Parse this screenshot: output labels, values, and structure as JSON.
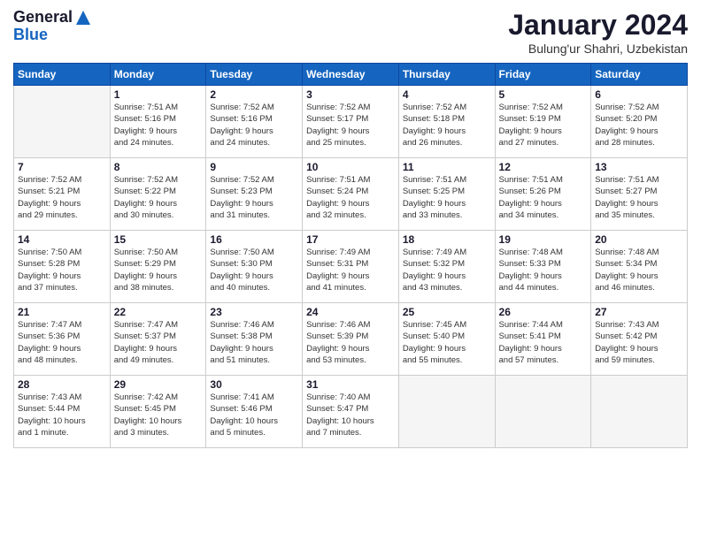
{
  "header": {
    "logo_line1": "General",
    "logo_line2": "Blue",
    "month_title": "January 2024",
    "location": "Bulung'ur Shahri, Uzbekistan"
  },
  "weekdays": [
    "Sunday",
    "Monday",
    "Tuesday",
    "Wednesday",
    "Thursday",
    "Friday",
    "Saturday"
  ],
  "weeks": [
    [
      {
        "day": "",
        "info": ""
      },
      {
        "day": "1",
        "info": "Sunrise: 7:51 AM\nSunset: 5:16 PM\nDaylight: 9 hours\nand 24 minutes."
      },
      {
        "day": "2",
        "info": "Sunrise: 7:52 AM\nSunset: 5:16 PM\nDaylight: 9 hours\nand 24 minutes."
      },
      {
        "day": "3",
        "info": "Sunrise: 7:52 AM\nSunset: 5:17 PM\nDaylight: 9 hours\nand 25 minutes."
      },
      {
        "day": "4",
        "info": "Sunrise: 7:52 AM\nSunset: 5:18 PM\nDaylight: 9 hours\nand 26 minutes."
      },
      {
        "day": "5",
        "info": "Sunrise: 7:52 AM\nSunset: 5:19 PM\nDaylight: 9 hours\nand 27 minutes."
      },
      {
        "day": "6",
        "info": "Sunrise: 7:52 AM\nSunset: 5:20 PM\nDaylight: 9 hours\nand 28 minutes."
      }
    ],
    [
      {
        "day": "7",
        "info": "Sunrise: 7:52 AM\nSunset: 5:21 PM\nDaylight: 9 hours\nand 29 minutes."
      },
      {
        "day": "8",
        "info": "Sunrise: 7:52 AM\nSunset: 5:22 PM\nDaylight: 9 hours\nand 30 minutes."
      },
      {
        "day": "9",
        "info": "Sunrise: 7:52 AM\nSunset: 5:23 PM\nDaylight: 9 hours\nand 31 minutes."
      },
      {
        "day": "10",
        "info": "Sunrise: 7:51 AM\nSunset: 5:24 PM\nDaylight: 9 hours\nand 32 minutes."
      },
      {
        "day": "11",
        "info": "Sunrise: 7:51 AM\nSunset: 5:25 PM\nDaylight: 9 hours\nand 33 minutes."
      },
      {
        "day": "12",
        "info": "Sunrise: 7:51 AM\nSunset: 5:26 PM\nDaylight: 9 hours\nand 34 minutes."
      },
      {
        "day": "13",
        "info": "Sunrise: 7:51 AM\nSunset: 5:27 PM\nDaylight: 9 hours\nand 35 minutes."
      }
    ],
    [
      {
        "day": "14",
        "info": "Sunrise: 7:50 AM\nSunset: 5:28 PM\nDaylight: 9 hours\nand 37 minutes."
      },
      {
        "day": "15",
        "info": "Sunrise: 7:50 AM\nSunset: 5:29 PM\nDaylight: 9 hours\nand 38 minutes."
      },
      {
        "day": "16",
        "info": "Sunrise: 7:50 AM\nSunset: 5:30 PM\nDaylight: 9 hours\nand 40 minutes."
      },
      {
        "day": "17",
        "info": "Sunrise: 7:49 AM\nSunset: 5:31 PM\nDaylight: 9 hours\nand 41 minutes."
      },
      {
        "day": "18",
        "info": "Sunrise: 7:49 AM\nSunset: 5:32 PM\nDaylight: 9 hours\nand 43 minutes."
      },
      {
        "day": "19",
        "info": "Sunrise: 7:48 AM\nSunset: 5:33 PM\nDaylight: 9 hours\nand 44 minutes."
      },
      {
        "day": "20",
        "info": "Sunrise: 7:48 AM\nSunset: 5:34 PM\nDaylight: 9 hours\nand 46 minutes."
      }
    ],
    [
      {
        "day": "21",
        "info": "Sunrise: 7:47 AM\nSunset: 5:36 PM\nDaylight: 9 hours\nand 48 minutes."
      },
      {
        "day": "22",
        "info": "Sunrise: 7:47 AM\nSunset: 5:37 PM\nDaylight: 9 hours\nand 49 minutes."
      },
      {
        "day": "23",
        "info": "Sunrise: 7:46 AM\nSunset: 5:38 PM\nDaylight: 9 hours\nand 51 minutes."
      },
      {
        "day": "24",
        "info": "Sunrise: 7:46 AM\nSunset: 5:39 PM\nDaylight: 9 hours\nand 53 minutes."
      },
      {
        "day": "25",
        "info": "Sunrise: 7:45 AM\nSunset: 5:40 PM\nDaylight: 9 hours\nand 55 minutes."
      },
      {
        "day": "26",
        "info": "Sunrise: 7:44 AM\nSunset: 5:41 PM\nDaylight: 9 hours\nand 57 minutes."
      },
      {
        "day": "27",
        "info": "Sunrise: 7:43 AM\nSunset: 5:42 PM\nDaylight: 9 hours\nand 59 minutes."
      }
    ],
    [
      {
        "day": "28",
        "info": "Sunrise: 7:43 AM\nSunset: 5:44 PM\nDaylight: 10 hours\nand 1 minute."
      },
      {
        "day": "29",
        "info": "Sunrise: 7:42 AM\nSunset: 5:45 PM\nDaylight: 10 hours\nand 3 minutes."
      },
      {
        "day": "30",
        "info": "Sunrise: 7:41 AM\nSunset: 5:46 PM\nDaylight: 10 hours\nand 5 minutes."
      },
      {
        "day": "31",
        "info": "Sunrise: 7:40 AM\nSunset: 5:47 PM\nDaylight: 10 hours\nand 7 minutes."
      },
      {
        "day": "",
        "info": ""
      },
      {
        "day": "",
        "info": ""
      },
      {
        "day": "",
        "info": ""
      }
    ]
  ]
}
